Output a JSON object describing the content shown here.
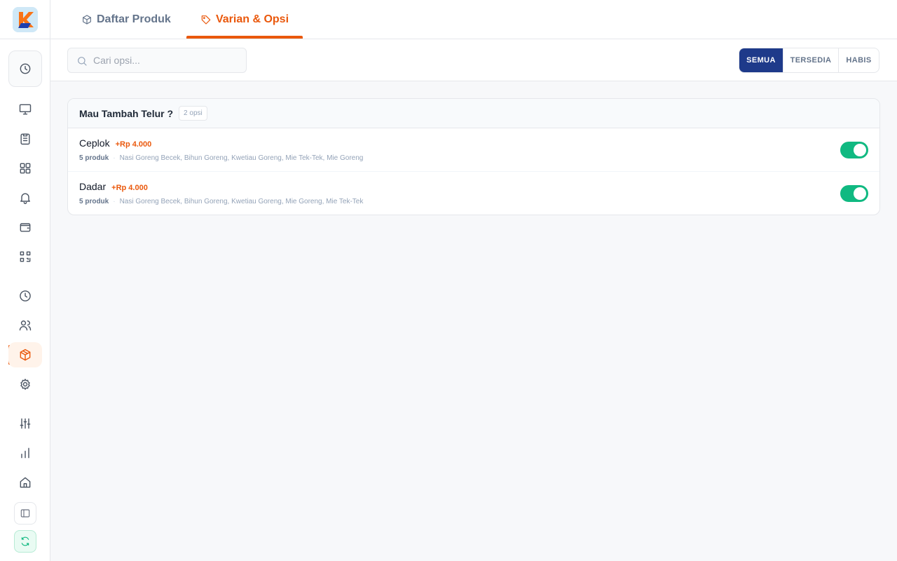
{
  "tabs": [
    {
      "label": "Daftar Produk",
      "icon": "cube-icon",
      "active": false
    },
    {
      "label": "Varian & Opsi",
      "icon": "tag-icon",
      "active": true
    }
  ],
  "search": {
    "placeholder": "Cari opsi...",
    "value": ""
  },
  "filters": [
    {
      "label": "SEMUA",
      "active": true
    },
    {
      "label": "TERSEDIA",
      "active": false
    },
    {
      "label": "HABIS",
      "active": false
    }
  ],
  "sidebar": {
    "icons": [
      "clock-icon",
      "monitor-icon",
      "clipboard-icon",
      "grid-icon",
      "bell-icon",
      "wallet-icon",
      "qr-scan-icon",
      "history-icon",
      "users-icon",
      "package-icon",
      "gear-icon",
      "sliders-icon",
      "bar-chart-icon",
      "home-icon",
      "panel-icon",
      "sync-icon"
    ],
    "active": "package-icon"
  },
  "group": {
    "title": "Mau Tambah Telur ?",
    "count": "2 opsi",
    "options": [
      {
        "name": "Ceplok",
        "price": "+Rp 4.000",
        "product_count": "5 produk",
        "products": "Nasi Goreng Becek, Bihun Goreng, Kwetiau Goreng, Mie Tek-Tek, Mie Goreng",
        "enabled": true
      },
      {
        "name": "Dadar",
        "price": "+Rp 4.000",
        "product_count": "5 produk",
        "products": "Nasi Goreng Becek, Bihun Goreng, Kwetiau Goreng, Mie Goreng, Mie Tek-Tek",
        "enabled": true
      }
    ]
  },
  "colors": {
    "accent": "#ea580c",
    "primary": "#1e3a8a",
    "toggle_on": "#10b981"
  }
}
